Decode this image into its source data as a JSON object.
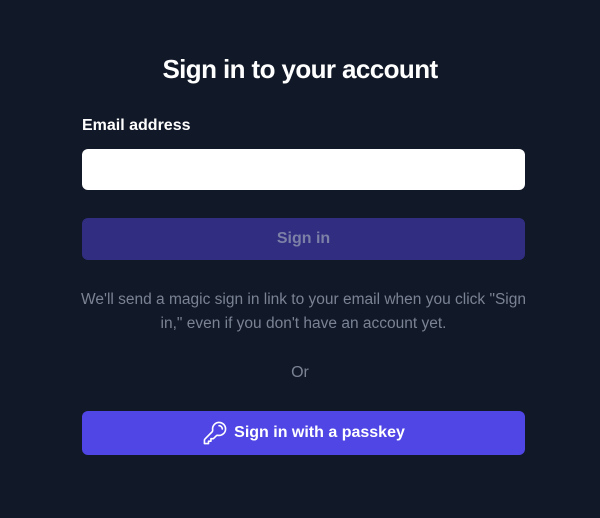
{
  "page": {
    "title": "Sign in to your account"
  },
  "form": {
    "email_label": "Email address",
    "email_value": "",
    "email_placeholder": "",
    "sign_in_label": "Sign in",
    "help_text": "We'll send a magic sign in link to your email when you click \"Sign in,\" even if you don't have an account yet.",
    "divider_text": "Or",
    "passkey_label": "Sign in with a passkey",
    "passkey_icon": "key-icon"
  },
  "colors": {
    "background": "#111827",
    "sign_in_button_disabled": "#312e81",
    "passkey_button": "#4f46e5",
    "muted_text": "#7a8394"
  }
}
